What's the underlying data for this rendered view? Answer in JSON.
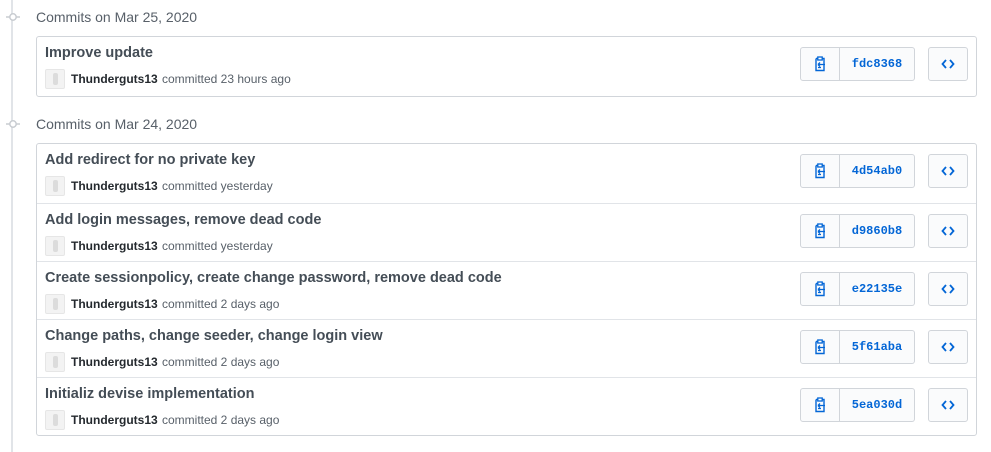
{
  "groups": [
    {
      "title": "Commits on Mar 25, 2020",
      "commits": [
        {
          "message": "Improve update",
          "author": "Thunderguts13",
          "verb": "committed 23 hours ago",
          "sha": "fdc8368"
        }
      ]
    },
    {
      "title": "Commits on Mar 24, 2020",
      "commits": [
        {
          "message": "Add redirect for no private key",
          "author": "Thunderguts13",
          "verb": "committed yesterday",
          "sha": "4d54ab0"
        },
        {
          "message": "Add login messages, remove dead code",
          "author": "Thunderguts13",
          "verb": "committed yesterday",
          "sha": "d9860b8"
        },
        {
          "message": "Create sessionpolicy, create change password, remove dead code",
          "author": "Thunderguts13",
          "verb": "committed 2 days ago",
          "sha": "e22135e"
        },
        {
          "message": "Change paths, change seeder, change login view",
          "author": "Thunderguts13",
          "verb": "committed 2 days ago",
          "sha": "5f61aba"
        },
        {
          "message": "Initializ devise implementation",
          "author": "Thunderguts13",
          "verb": "committed 2 days ago",
          "sha": "5ea030d"
        }
      ]
    }
  ],
  "icons": {
    "timeline_node": "git-commit-icon",
    "copy": "clipboard-icon",
    "browse": "code-icon"
  },
  "colors": {
    "link": "#0366d6",
    "muted": "#586069",
    "border": "#d1d5da"
  }
}
